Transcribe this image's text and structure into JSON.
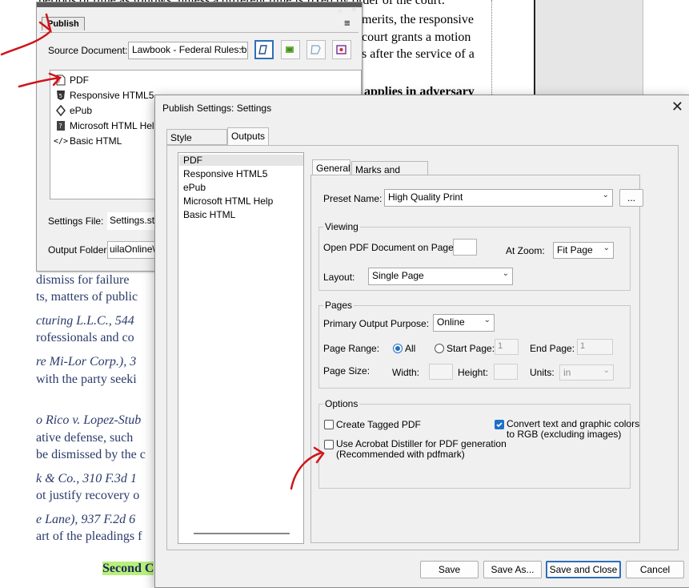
{
  "document": {
    "lines_top": [
      "periods of time as follows, unless a different time is fixed by order of the court:",
      "merits, the responsive",
      "court grants a motion",
      "s after the service of a",
      "applies in adversary"
    ],
    "lines_body": [
      "dismiss  for  failure",
      "ts, matters of public",
      "cturing L.L.C., 544",
      "rofessionals and co",
      "re Mi-Lor Corp.), 3",
      "with  the  party  seeki",
      "o Rico v. Lopez-Stub",
      "ative  defense,  such",
      "be dismissed by the c",
      "k & Co., 310 F.3d 1",
      "ot justify recovery o",
      "e Lane), 937 F.2d 6",
      "art of the pleadings f"
    ],
    "highlight_text": "Second C"
  },
  "publish_pod": {
    "tab_label": "Publish",
    "menu_icon": "hamburger-icon",
    "source_label": "Source Document:",
    "source_value": "Lawbook - Federal Rules.b",
    "outputs": [
      {
        "label": "PDF",
        "icon": "pdf-icon"
      },
      {
        "label": "Responsive HTML5",
        "icon": "html5-icon"
      },
      {
        "label": "ePub",
        "icon": "epub-icon"
      },
      {
        "label": "Microsoft HTML Help",
        "icon": "chm-icon"
      },
      {
        "label": "Basic HTML",
        "icon": "code-icon"
      }
    ],
    "settings_file_label": "Settings File:",
    "settings_file_value": "Settings.sts",
    "output_folder_label": "Output Folder:",
    "output_folder_value": "uilaOnline\\Pr"
  },
  "dialog": {
    "title": "Publish Settings: Settings",
    "tabs": [
      "Style Mapping",
      "Outputs"
    ],
    "output_list": [
      "PDF",
      "Responsive HTML5",
      "ePub",
      "Microsoft HTML Help",
      "Basic HTML"
    ],
    "subtabs": [
      "General",
      "Marks and Bleeds"
    ],
    "preset_label": "Preset Name:",
    "preset_value": "High Quality Print",
    "browse_label": "...",
    "viewing": {
      "title": "Viewing",
      "open_label": "Open PDF Document on Page:",
      "open_value": "",
      "zoom_label": "At Zoom:",
      "zoom_value": "Fit Page",
      "layout_label": "Layout:",
      "layout_value": "Single Page"
    },
    "pages": {
      "title": "Pages",
      "purpose_label": "Primary Output Purpose:",
      "purpose_value": "Online",
      "range_label": "Page Range:",
      "all_label": "All",
      "start_label": "Start Page:",
      "start_value": "1",
      "end_label": "End Page:",
      "end_value": "1",
      "size_label": "Page Size:",
      "width_label": "Width:",
      "height_label": "Height:",
      "units_label": "Units:",
      "units_value": "in"
    },
    "options": {
      "title": "Options",
      "tagged_label": "Create Tagged PDF",
      "distiller_label_1": "Use Acrobat Distiller for PDF generation",
      "distiller_label_2": "(Recommended with pdfmark)",
      "convert_label_1": "Convert text and graphic colors",
      "convert_label_2": "to RGB (excluding images)"
    },
    "buttons": {
      "save": "Save",
      "save_as": "Save As...",
      "save_close": "Save and Close",
      "cancel": "Cancel"
    }
  },
  "colors": {
    "accent": "#1f6fc8",
    "annotation": "#d0141a",
    "highlight": "#b9f07b"
  }
}
